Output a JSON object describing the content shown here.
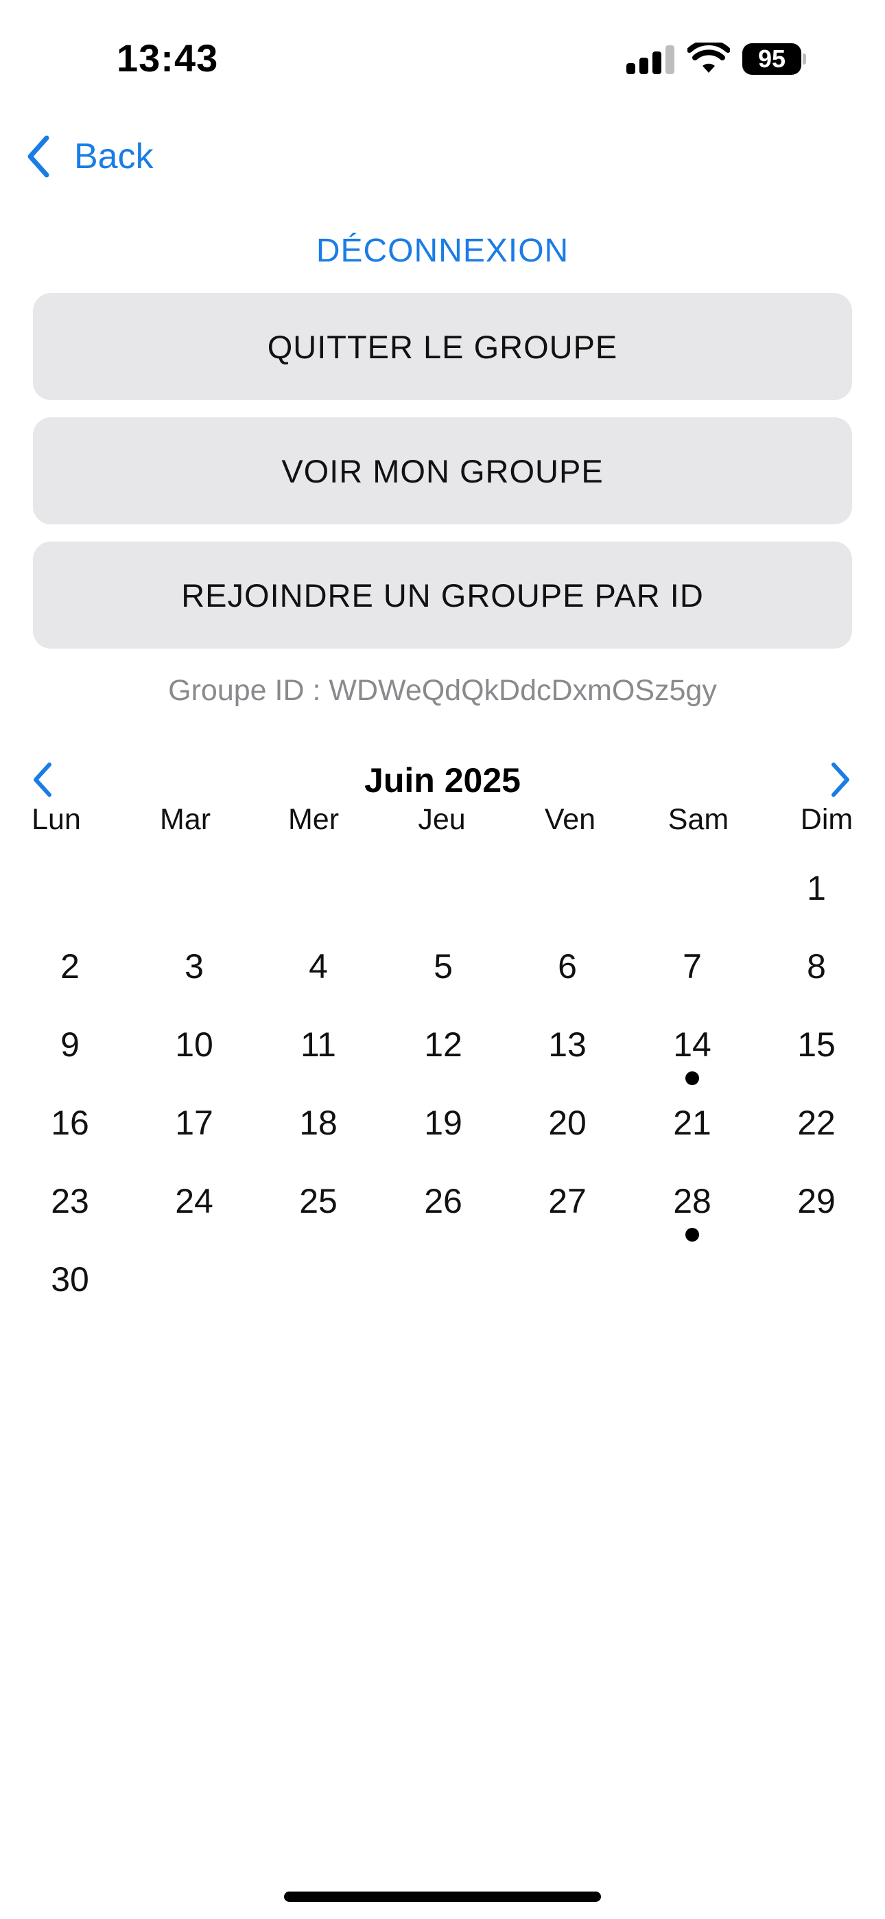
{
  "status_bar": {
    "time": "13:43",
    "battery": "95",
    "icons": [
      "signal-icon",
      "wifi-icon",
      "battery-icon"
    ]
  },
  "nav": {
    "back_label": "Back",
    "back_icon": "chevron-left-icon"
  },
  "logout_label": "DÉCONNEXION",
  "actions": {
    "leave_group": "QUITTER LE GROUPE",
    "view_group": "VOIR MON GROUPE",
    "join_by_id": "REJOINDRE UN GROUPE PAR ID"
  },
  "group_id_text": "Groupe ID : WDWeQdQkDdcDxmOSz5gy",
  "calendar": {
    "title": "Juin 2025",
    "weekdays": [
      "Lun",
      "Mar",
      "Mer",
      "Jeu",
      "Ven",
      "Sam",
      "Dim"
    ],
    "first_weekday_index": 6,
    "days_in_month": 30,
    "marked_days": [
      14,
      28
    ]
  },
  "colors": {
    "accent": "#1a7ce6",
    "button_bg": "#e7e7ea",
    "muted_text": "#8a8a8e"
  }
}
